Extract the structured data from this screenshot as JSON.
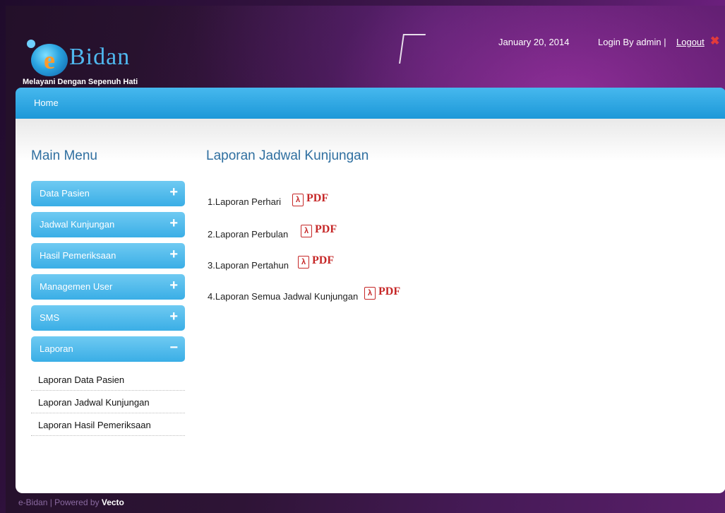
{
  "header": {
    "logo_letter": "e",
    "logo_word": "Bidan",
    "tagline": "Melayani Dengan Sepenuh Hati",
    "date": "January 20, 2014",
    "login_text": "Login By admin |",
    "logout_label": "Logout",
    "logout_icon": "✖"
  },
  "nav": {
    "home_label": "Home"
  },
  "sidebar": {
    "title": "Main Menu",
    "items": [
      {
        "label": "Data Pasien",
        "sign": "+"
      },
      {
        "label": "Jadwal Kunjungan",
        "sign": "+"
      },
      {
        "label": "Hasil Pemeriksaan",
        "sign": "+"
      },
      {
        "label": "Managemen User",
        "sign": "+"
      },
      {
        "label": "SMS",
        "sign": "+"
      },
      {
        "label": "Laporan",
        "sign": "−"
      }
    ],
    "sub_items": [
      {
        "label": "Laporan Data Pasien"
      },
      {
        "label": "Laporan Jadwal Kunjungan"
      },
      {
        "label": "Laporan Hasil Pemeriksaan"
      }
    ]
  },
  "main": {
    "title": "Laporan Jadwal Kunjungan",
    "reports": [
      {
        "label": "1.Laporan Perhari",
        "link": "PDF"
      },
      {
        "label": "2.Laporan Perbulan",
        "link": "PDF"
      },
      {
        "label": "3.Laporan Pertahun",
        "link": "PDF"
      },
      {
        "label": "4.Laporan Semua Jadwal Kunjungan",
        "link": "PDF"
      }
    ]
  },
  "footer": {
    "text": "e-Bidan | Powered by",
    "brand": "Vecto"
  }
}
